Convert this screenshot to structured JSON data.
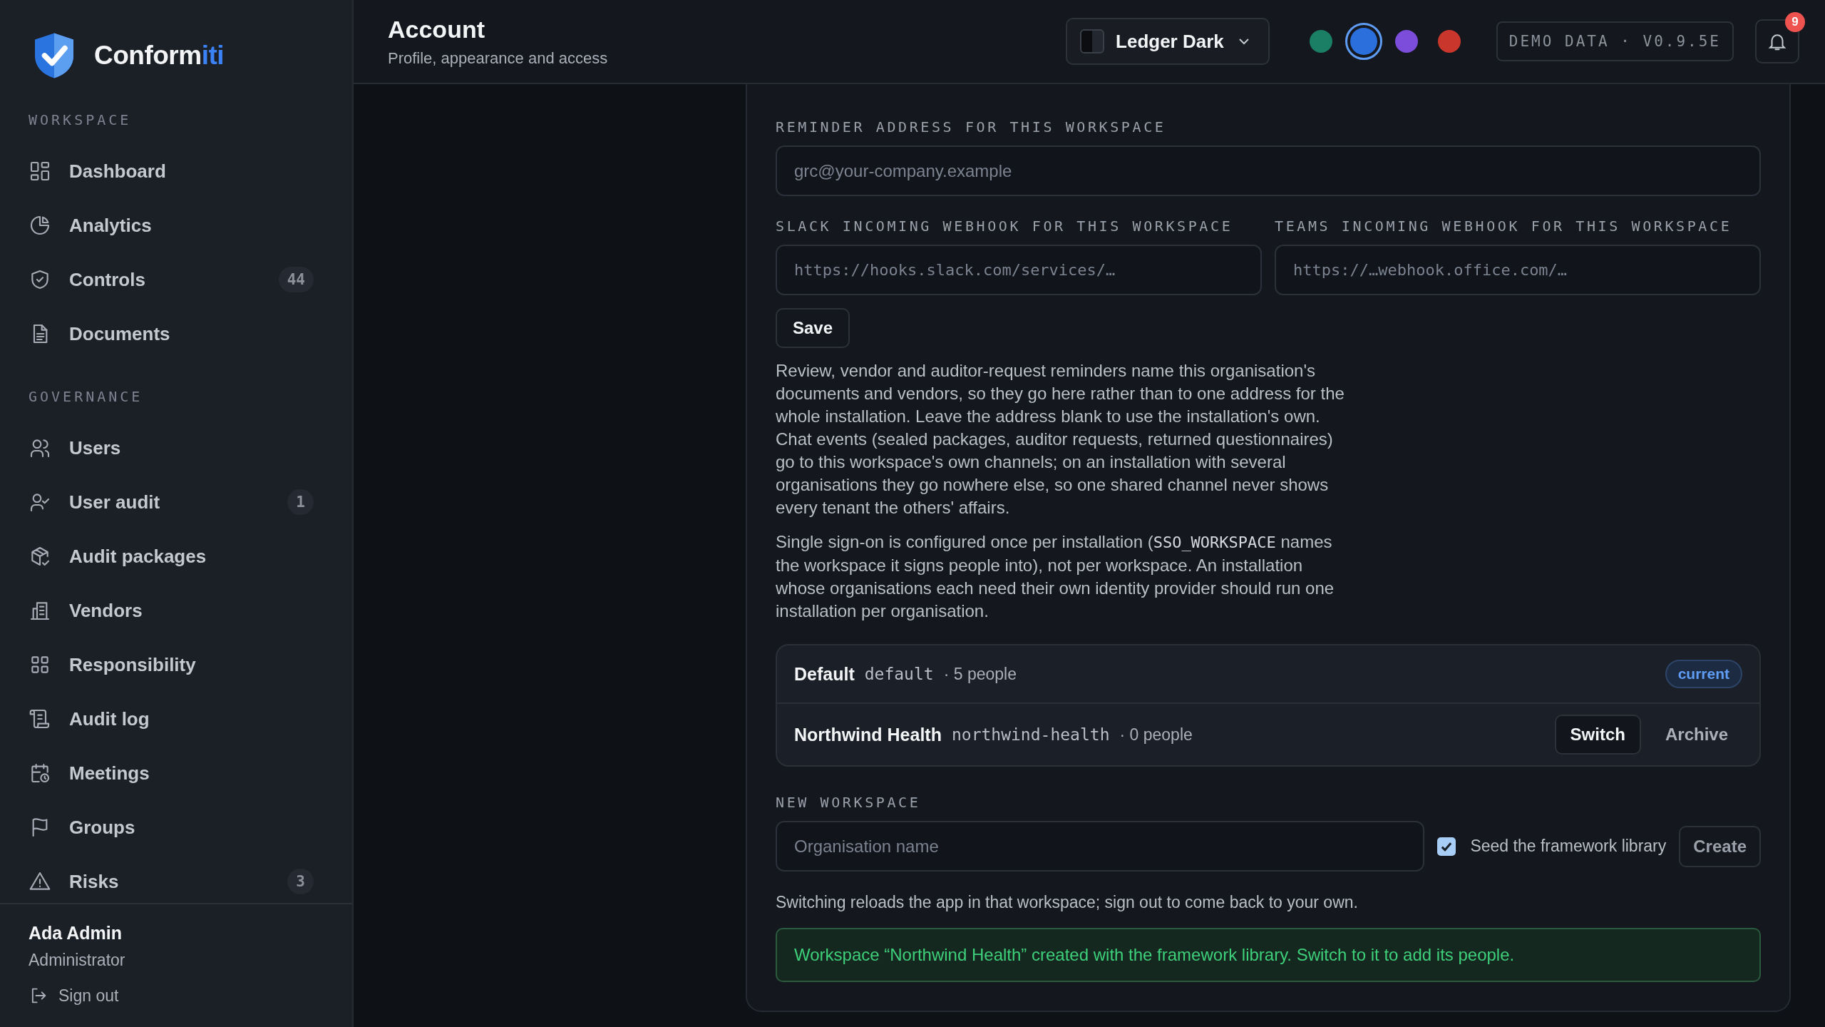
{
  "brand": {
    "name": "Conform",
    "accent": "iti"
  },
  "sidebar": {
    "sections": [
      {
        "title": "WORKSPACE",
        "items": [
          {
            "label": "Dashboard"
          },
          {
            "label": "Analytics"
          },
          {
            "label": "Controls",
            "count": "44"
          },
          {
            "label": "Documents"
          }
        ]
      },
      {
        "title": "GOVERNANCE",
        "items": [
          {
            "label": "Users"
          },
          {
            "label": "User audit",
            "count": "1"
          },
          {
            "label": "Audit packages"
          },
          {
            "label": "Vendors"
          },
          {
            "label": "Responsibility"
          },
          {
            "label": "Audit log"
          },
          {
            "label": "Meetings"
          },
          {
            "label": "Groups"
          },
          {
            "label": "Risks",
            "count": "3"
          }
        ]
      }
    ]
  },
  "user": {
    "name": "Ada Admin",
    "role": "Administrator",
    "sign_out": "Sign out"
  },
  "header": {
    "title": "Account",
    "subtitle": "Profile, appearance and access",
    "theme": "Ledger Dark",
    "accents": [
      {
        "color": "#1a7f64",
        "selected": false
      },
      {
        "color": "#2a6fdb",
        "selected": true
      },
      {
        "color": "#7c4ddb",
        "selected": false
      },
      {
        "color": "#c9372c",
        "selected": false
      }
    ],
    "demo_badge": "DEMO DATA · V0.9.5E",
    "notifications": "9"
  },
  "form": {
    "reminder_label": "REMINDER ADDRESS FOR THIS WORKSPACE",
    "reminder_placeholder": "grc@your-company.example",
    "slack_label": "SLACK INCOMING WEBHOOK FOR THIS WORKSPACE",
    "slack_placeholder": "https://hooks.slack.com/services/…",
    "teams_label": "TEAMS INCOMING WEBHOOK FOR THIS WORKSPACE",
    "teams_placeholder": "https://…webhook.office.com/…",
    "save": "Save",
    "paragraphs": [
      "Review, vendor and auditor-request reminders name this organisation's documents and vendors, so they go here rather than to one address for the whole installation. Leave the address blank to use the installation's own. Chat events (sealed packages, auditor requests, returned questionnaires) go to this workspace's own channels; on an installation with several organisations they go nowhere else, so one shared channel never shows every tenant the others' affairs.",
      {
        "before": "Single sign-on is configured once per installation (",
        "code": "SSO_WORKSPACE",
        "after": " names the workspace it signs people into), not per workspace. An installation whose organisations each need their own identity provider should run one installation per organisation."
      }
    ]
  },
  "workspaces": [
    {
      "name": "Default",
      "slug": "default",
      "people": "· 5 people",
      "current": true,
      "badge": "current"
    },
    {
      "name": "Northwind Health",
      "slug": "northwind-health",
      "people": "· 0 people",
      "current": false,
      "switch": "Switch",
      "archive": "Archive"
    }
  ],
  "new_workspace": {
    "label": "NEW WORKSPACE",
    "placeholder": "Organisation name",
    "seed_label": "Seed the framework library",
    "seed_checked": true,
    "create": "Create",
    "hint": "Switching reloads the app in that workspace; sign out to come back to your own.",
    "success": "Workspace “Northwind Health” created with the framework library. Switch to it to add its people."
  }
}
